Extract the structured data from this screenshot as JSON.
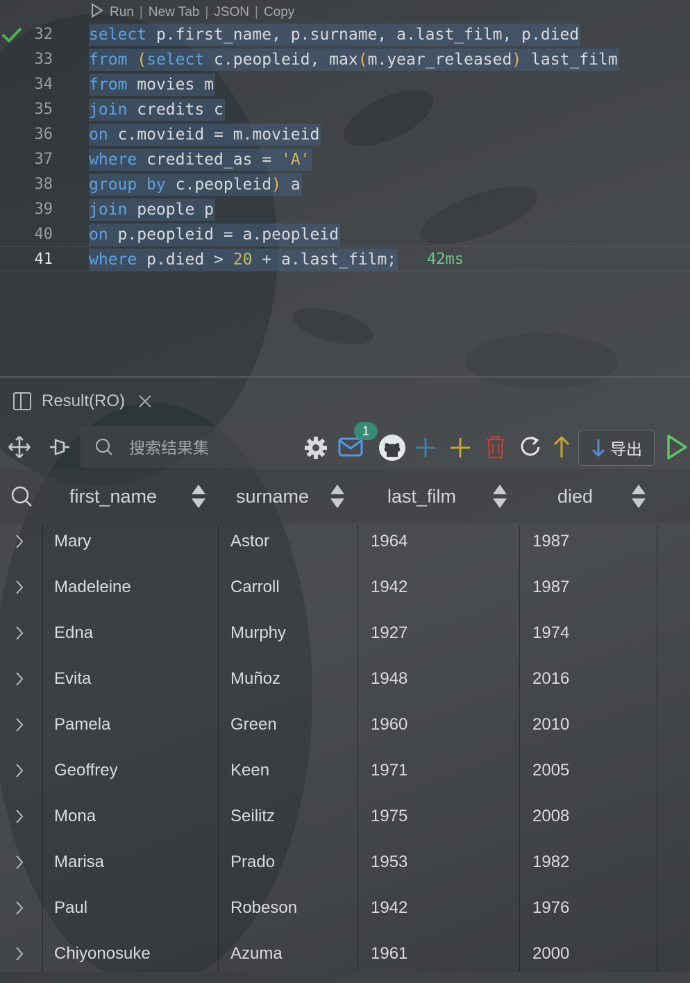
{
  "editor": {
    "codelens": {
      "run": "Run",
      "new_tab": "New Tab",
      "json": "JSON",
      "copy": "Copy",
      "separator": "|"
    },
    "lines": [
      {
        "number": "32",
        "tokens": [
          [
            "kw",
            "select"
          ],
          [
            "id",
            " p.first_name, p.surname, a.last_film, p.died"
          ]
        ]
      },
      {
        "number": "33",
        "tokens": [
          [
            "kw",
            "from"
          ],
          [
            "id",
            " "
          ],
          [
            "paren",
            "("
          ],
          [
            "kw",
            "select"
          ],
          [
            "id",
            " c.peopleid, max"
          ],
          [
            "paren",
            "("
          ],
          [
            "id",
            "m.year_released"
          ],
          [
            "paren",
            ")"
          ],
          [
            "id",
            " last_film"
          ]
        ]
      },
      {
        "number": "34",
        "tokens": [
          [
            "kw",
            "from"
          ],
          [
            "id",
            " movies m"
          ]
        ]
      },
      {
        "number": "35",
        "tokens": [
          [
            "kw",
            "join"
          ],
          [
            "id",
            " credits c"
          ]
        ]
      },
      {
        "number": "36",
        "tokens": [
          [
            "kw",
            "on"
          ],
          [
            "id",
            " c.movieid = m.movieid"
          ]
        ]
      },
      {
        "number": "37",
        "tokens": [
          [
            "kw",
            "where"
          ],
          [
            "id",
            " credited_as = "
          ],
          [
            "str",
            "'A'"
          ]
        ]
      },
      {
        "number": "38",
        "tokens": [
          [
            "kw",
            "group by"
          ],
          [
            "id",
            " c.peopleid"
          ],
          [
            "paren",
            ")"
          ],
          [
            "id",
            " a"
          ]
        ]
      },
      {
        "number": "39",
        "tokens": [
          [
            "kw",
            "join"
          ],
          [
            "id",
            " people p"
          ]
        ]
      },
      {
        "number": "40",
        "tokens": [
          [
            "kw",
            "on"
          ],
          [
            "id",
            " p.peopleid = a.peopleid"
          ]
        ]
      },
      {
        "number": "41",
        "tokens": [
          [
            "kw",
            "where"
          ],
          [
            "id",
            " p.died > "
          ],
          [
            "num",
            "20"
          ],
          [
            "id",
            " + a.last_film;"
          ]
        ]
      }
    ],
    "timing": "42ms"
  },
  "result_tab": {
    "label": "Result(RO)"
  },
  "toolbar": {
    "search_placeholder": "搜索结果集",
    "notification_count": "1",
    "export_label": "导出"
  },
  "table": {
    "columns": [
      "first_name",
      "surname",
      "last_film",
      "died"
    ],
    "rows": [
      [
        "Mary",
        "Astor",
        "1964",
        "1987"
      ],
      [
        "Madeleine",
        "Carroll",
        "1942",
        "1987"
      ],
      [
        "Edna",
        "Murphy",
        "1927",
        "1974"
      ],
      [
        "Evita",
        "Muñoz",
        "1948",
        "2016"
      ],
      [
        "Pamela",
        "Green",
        "1960",
        "2010"
      ],
      [
        "Geoffrey",
        "Keen",
        "1971",
        "2005"
      ],
      [
        "Mona",
        "Seilitz",
        "1975",
        "2008"
      ],
      [
        "Marisa",
        "Prado",
        "1953",
        "1982"
      ],
      [
        "Paul",
        "Robeson",
        "1942",
        "1976"
      ],
      [
        "Chiyonosuke",
        "Azuma",
        "1961",
        "2000"
      ]
    ]
  },
  "colors": {
    "keyword": "#5ea0e0",
    "string": "#c9b46a",
    "timing": "#6ec48a",
    "check": "#4caf50",
    "badge": "#3a8a78",
    "run": "#5ec46a",
    "add": "#c9a33a",
    "delete": "#b5443a",
    "up": "#c9a33a",
    "down": "#4f8fe0",
    "new_row": "#3f7fa0"
  }
}
